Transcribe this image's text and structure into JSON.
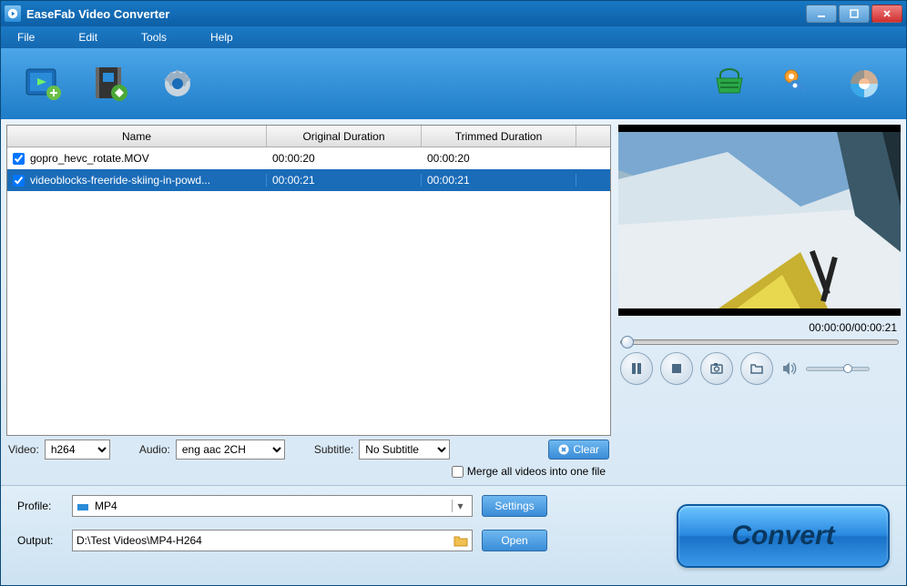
{
  "window": {
    "title": "EaseFab Video Converter"
  },
  "menu": {
    "file": "File",
    "edit": "Edit",
    "tools": "Tools",
    "help": "Help"
  },
  "table": {
    "headers": {
      "name": "Name",
      "orig": "Original Duration",
      "trim": "Trimmed Duration"
    },
    "rows": [
      {
        "name": "gopro_hevc_rotate.MOV",
        "orig": "00:00:20",
        "trim": "00:00:20",
        "selected": false,
        "checked": true
      },
      {
        "name": "videoblocks-freeride-skiing-in-powd...",
        "orig": "00:00:21",
        "trim": "00:00:21",
        "selected": true,
        "checked": true
      }
    ]
  },
  "controls": {
    "video_label": "Video:",
    "video_value": "h264",
    "audio_label": "Audio:",
    "audio_value": "eng aac 2CH",
    "subtitle_label": "Subtitle:",
    "subtitle_value": "No Subtitle",
    "clear_label": "Clear"
  },
  "merge_label": "Merge all videos into one file",
  "preview": {
    "time": "00:00:00/00:00:21"
  },
  "bottom": {
    "profile_label": "Profile:",
    "profile_value": "MP4",
    "output_label": "Output:",
    "output_value": "D:\\Test Videos\\MP4-H264",
    "settings_label": "Settings",
    "open_label": "Open"
  },
  "convert_label": "Convert"
}
